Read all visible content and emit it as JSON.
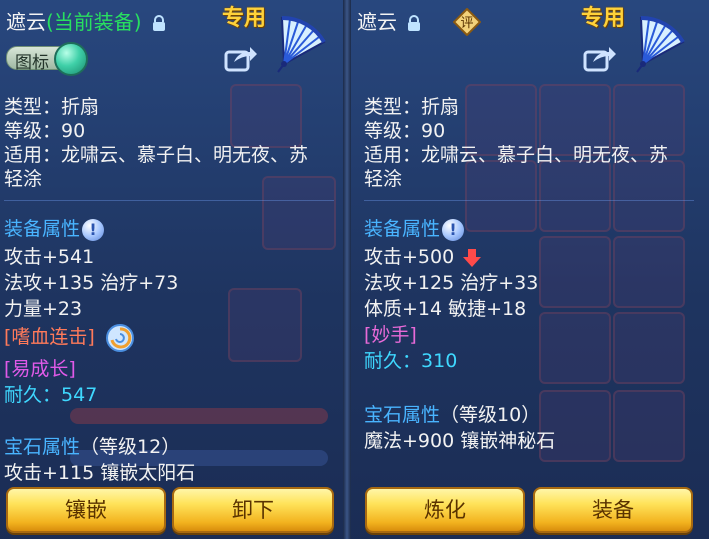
{
  "left": {
    "title_name": "遮云",
    "title_equipped": "(当前装备)",
    "special": "专用",
    "icon_toggle_label": "图标",
    "type": "类型：折扇",
    "level": "等级：90",
    "suitable_line1": "适用：龙啸云、慕子白、明无夜、苏",
    "suitable_line2": "轻涂",
    "attr_title": "装备属性",
    "attrs": [
      "攻击+541",
      "法攻+135 治疗+73",
      "力量+23"
    ],
    "skill": "[嗜血连击]",
    "effect": "[易成长]",
    "durability_label": "耐久：",
    "durability_value": "547",
    "gem_title": "宝石属性",
    "gem_level": "（等级12）",
    "gem_attr": "攻击+115 镶嵌太阳石",
    "buttons": [
      "镶嵌",
      "卸下"
    ]
  },
  "right": {
    "title_name": "遮云",
    "rate_badge": "评",
    "special": "专用",
    "type": "类型：折扇",
    "level": "等级：90",
    "suitable_line1": "适用：龙啸云、慕子白、明无夜、苏",
    "suitable_line2": "轻涂",
    "attr_title": "装备属性",
    "attrs": [
      "攻击+500",
      "法攻+125 治疗+33",
      "体质+14 敏捷+18"
    ],
    "effect": "[妙手]",
    "durability_label": "耐久：",
    "durability_value": "310",
    "gem_title": "宝石属性",
    "gem_level": "（等级10）",
    "gem_attr": "魔法+900 镶嵌神秘石",
    "buttons": [
      "炼化",
      "装备"
    ]
  },
  "colors": {
    "accent_gold": "#ffd23a",
    "section_blue": "#49b4ff",
    "equipped_green": "#28e060",
    "durability_cyan": "#3fd8ff",
    "skill_red": "#ff7a5a",
    "effect_purple": "#e05ae8"
  }
}
